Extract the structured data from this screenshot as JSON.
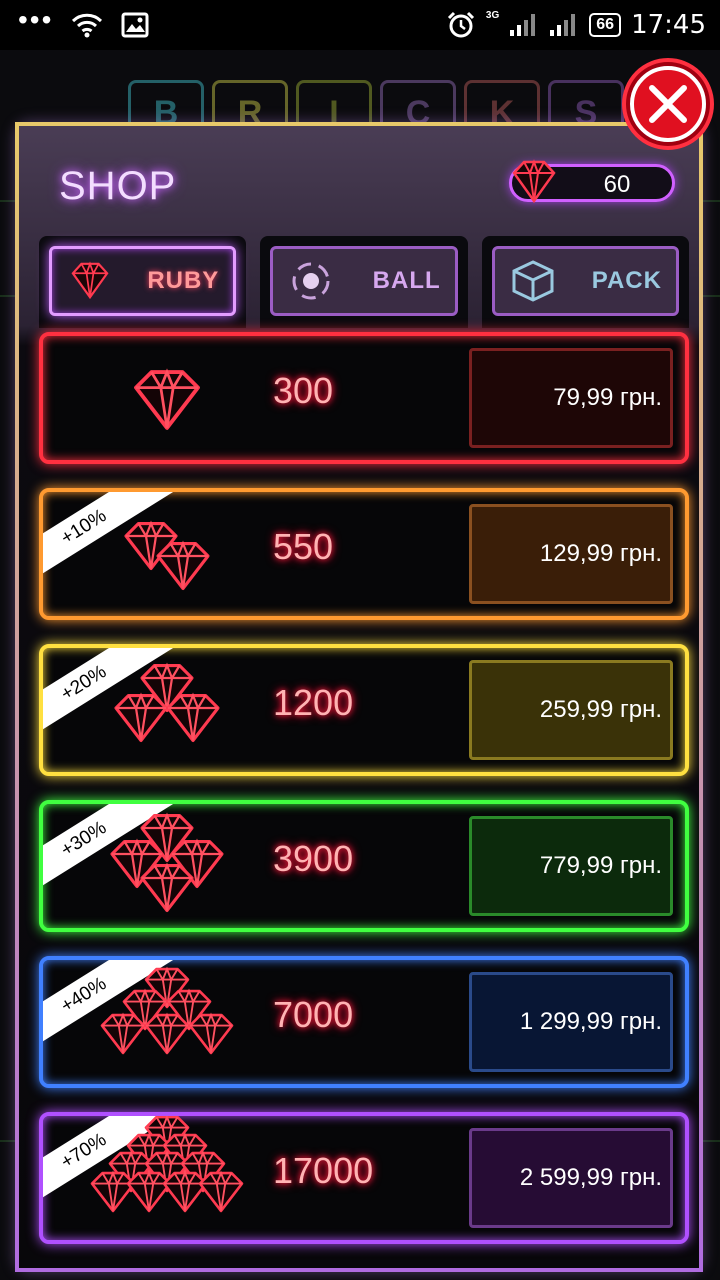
{
  "status_bar": {
    "time": "17:45",
    "battery": "66",
    "network": "3G"
  },
  "background_title_letters": [
    "B",
    "R",
    "I",
    "C",
    "K",
    "S"
  ],
  "shop": {
    "title": "SHOP",
    "ruby_count": "60"
  },
  "tabs": [
    {
      "label": "RUBY",
      "icon": "ruby-icon",
      "active": true
    },
    {
      "label": "BALL",
      "icon": "ball-icon",
      "active": false
    },
    {
      "label": "PACK",
      "icon": "cube-icon",
      "active": false
    }
  ],
  "offers": [
    {
      "amount": "300",
      "price": "79,99 грн.",
      "bonus": "",
      "color": "#ff3040",
      "btn_bg": "#1e0606",
      "btn_border": "#7a2020",
      "gems": 1
    },
    {
      "amount": "550",
      "price": "129,99 грн.",
      "bonus": "+10%",
      "color": "#ff9a30",
      "btn_bg": "#3a1e08",
      "btn_border": "#8a5020",
      "gems": 2
    },
    {
      "amount": "1200",
      "price": "259,99 грн.",
      "bonus": "+20%",
      "color": "#ffe040",
      "btn_bg": "#3a3208",
      "btn_border": "#8a7a20",
      "gems": 3
    },
    {
      "amount": "3900",
      "price": "779,99 грн.",
      "bonus": "+30%",
      "color": "#40ff40",
      "btn_bg": "#0c2a0c",
      "btn_border": "#2a8a2a",
      "gems": 4
    },
    {
      "amount": "7000",
      "price": "1 299,99 грн.",
      "bonus": "+40%",
      "color": "#4080ff",
      "btn_bg": "#081634",
      "btn_border": "#2a4a8a",
      "gems": 6
    },
    {
      "amount": "17000",
      "price": "2 599,99 грн.",
      "bonus": "+70%",
      "color": "#b050ff",
      "btn_bg": "#260c34",
      "btn_border": "#6a3a8a",
      "gems": 10
    }
  ],
  "close_button_icon": "close-icon"
}
